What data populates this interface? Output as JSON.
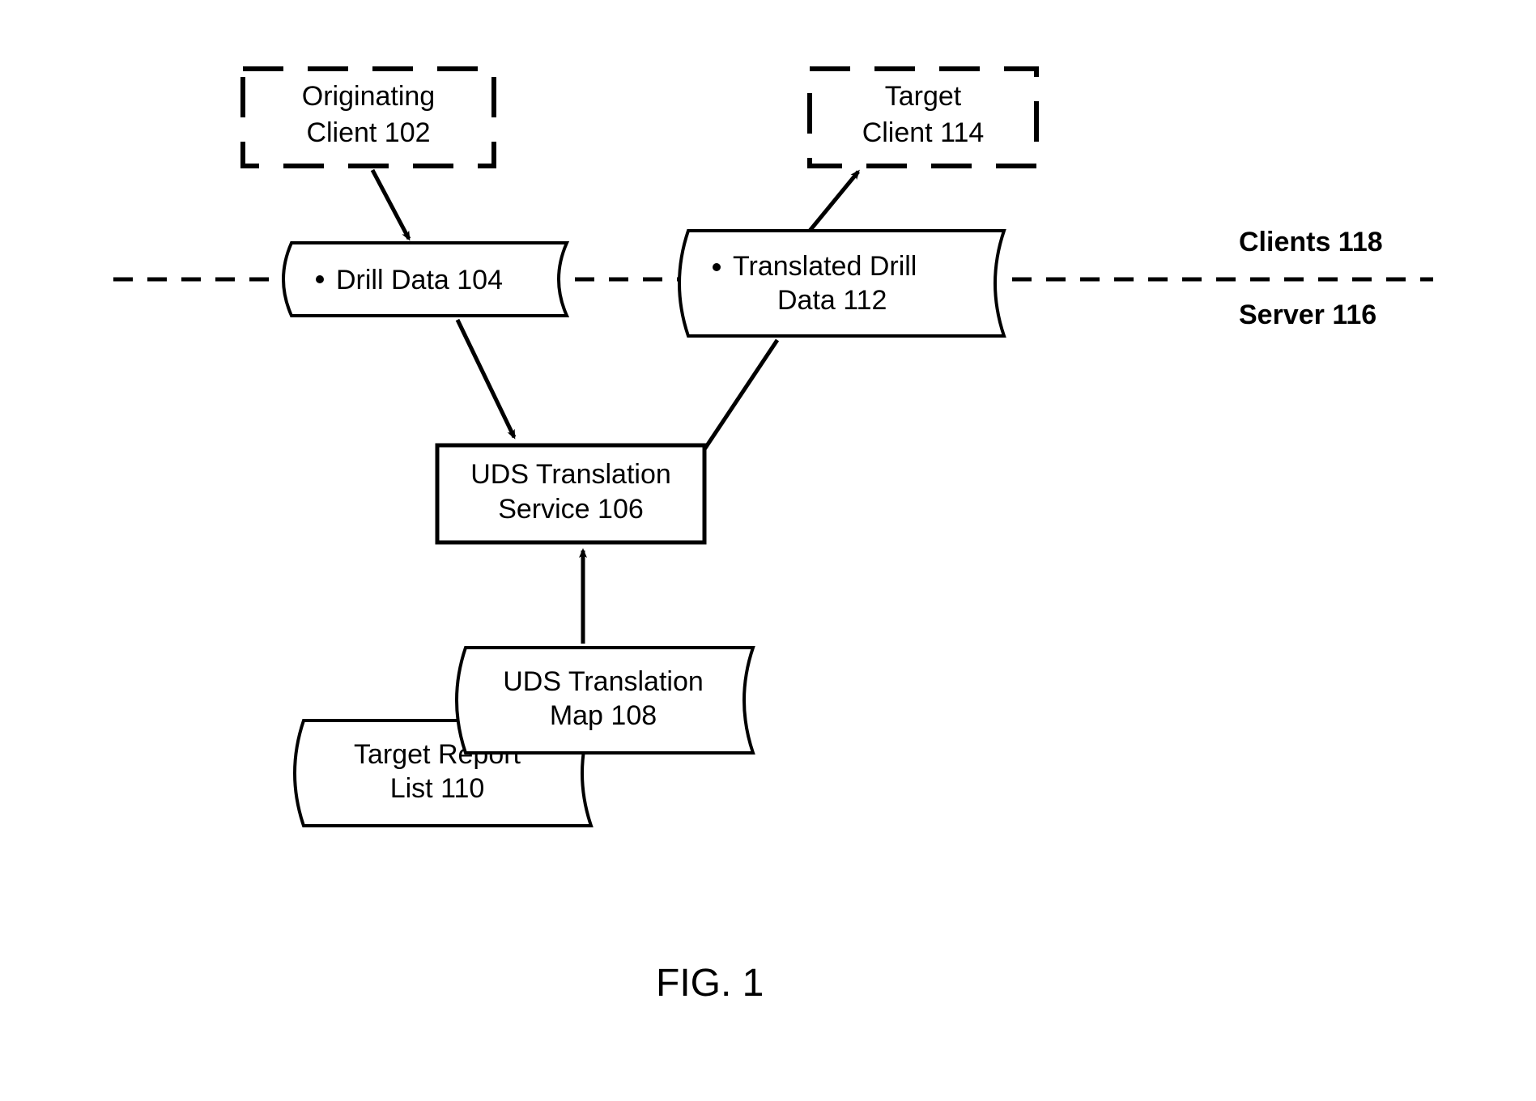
{
  "nodes": {
    "originating_client": {
      "line1": "Originating",
      "line2": "Client 102"
    },
    "target_client": {
      "line1": "Target",
      "line2": "Client 114"
    },
    "drill_data": {
      "line1": "Drill Data 104"
    },
    "translated_drill": {
      "line1": "Translated Drill",
      "line2": "Data 112"
    },
    "uds_service": {
      "line1": "UDS Translation",
      "line2": "Service 106"
    },
    "uds_map": {
      "line1": "UDS Translation",
      "line2": "Map 108"
    },
    "target_report": {
      "line1": "Target Report",
      "line2": "List 110"
    }
  },
  "labels": {
    "clients": "Clients 118",
    "server": "Server 116"
  },
  "figure": "FIG. 1"
}
